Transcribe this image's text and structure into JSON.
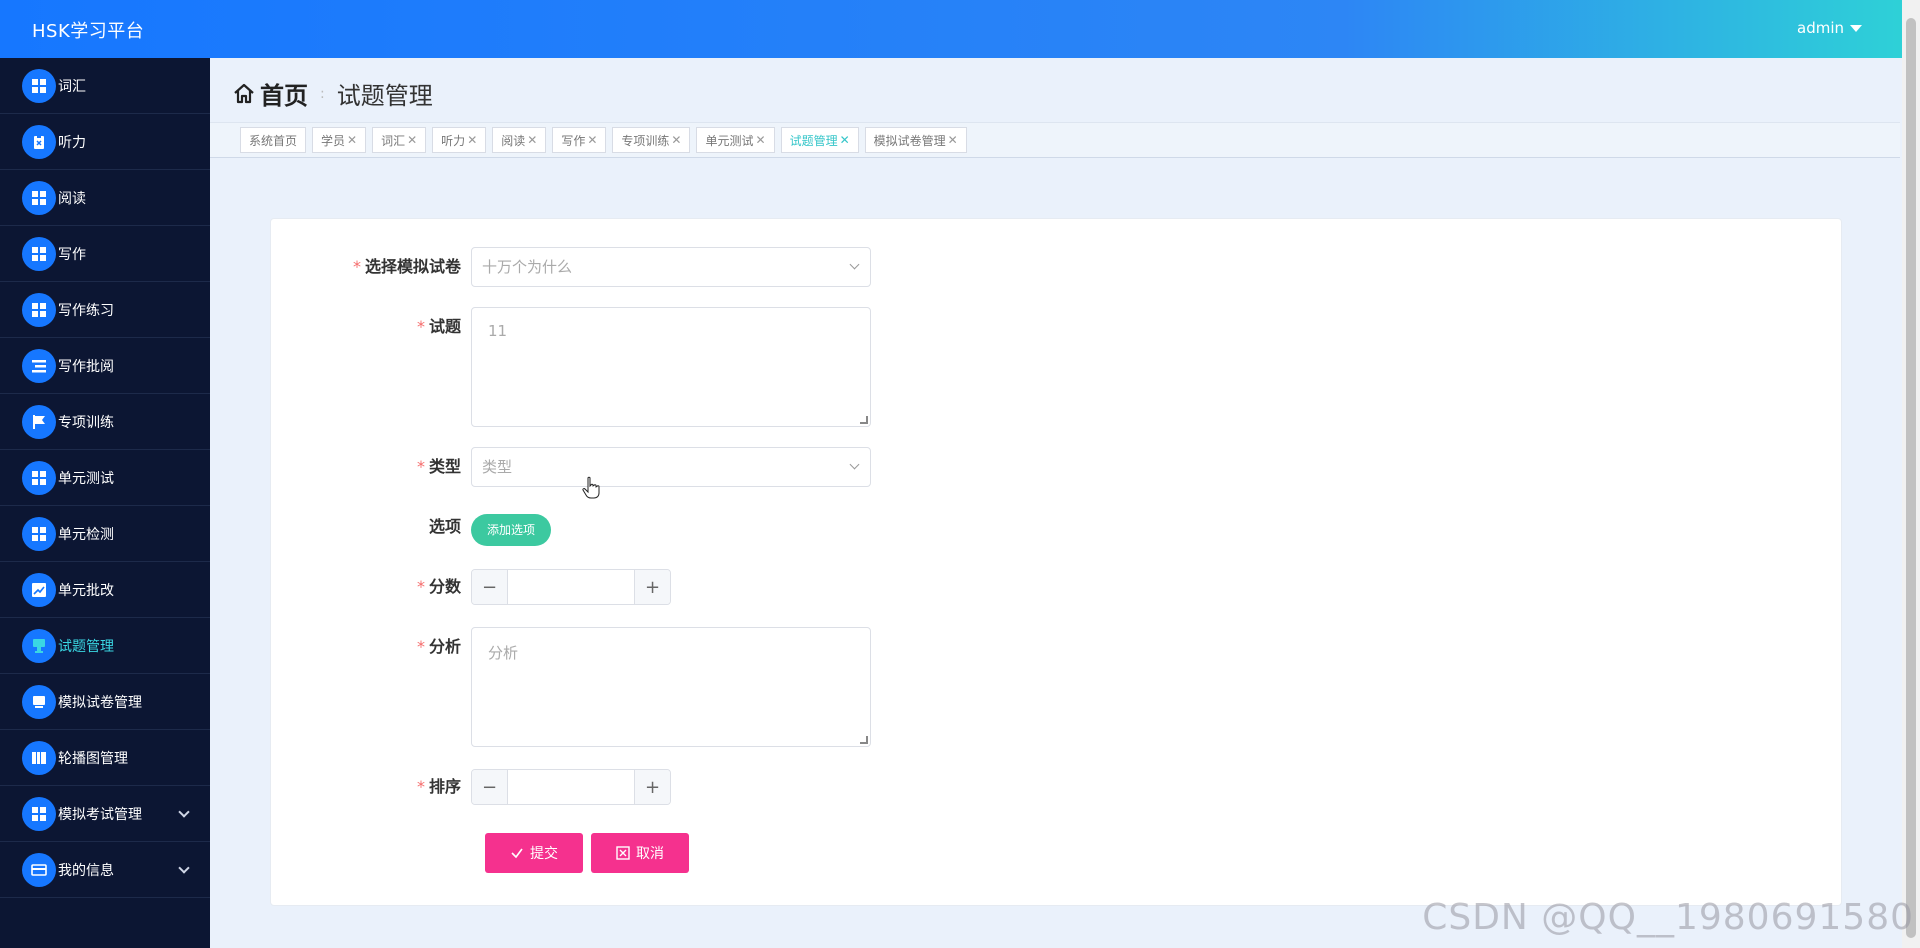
{
  "header": {
    "brand": "HSK学习平台",
    "user": "admin"
  },
  "sidebar": {
    "items": [
      {
        "label": "词汇",
        "icon": "grid-icon"
      },
      {
        "label": "听力",
        "icon": "clipboard-icon"
      },
      {
        "label": "阅读",
        "icon": "grid-icon"
      },
      {
        "label": "写作",
        "icon": "grid-icon"
      },
      {
        "label": "写作练习",
        "icon": "grid-icon"
      },
      {
        "label": "写作批阅",
        "icon": "list-icon"
      },
      {
        "label": "专项训练",
        "icon": "flag-icon"
      },
      {
        "label": "单元测试",
        "icon": "grid-icon"
      },
      {
        "label": "单元检测",
        "icon": "grid-icon"
      },
      {
        "label": "单元批改",
        "icon": "chart-icon"
      },
      {
        "label": "试题管理",
        "icon": "cup-icon",
        "active": true
      },
      {
        "label": "模拟试卷管理",
        "icon": "monitor-icon"
      },
      {
        "label": "轮播图管理",
        "icon": "book-icon"
      },
      {
        "label": "模拟考试管理",
        "icon": "grid-icon",
        "expandable": true
      },
      {
        "label": "我的信息",
        "icon": "card-icon",
        "expandable": true
      }
    ]
  },
  "breadcrumb": {
    "home": "首页",
    "separator": ":",
    "current": "试题管理"
  },
  "tags": [
    {
      "label": "系统首页",
      "closable": false
    },
    {
      "label": "学员",
      "closable": true
    },
    {
      "label": "词汇",
      "closable": true
    },
    {
      "label": "听力",
      "closable": true
    },
    {
      "label": "阅读",
      "closable": true
    },
    {
      "label": "写作",
      "closable": true
    },
    {
      "label": "专项训练",
      "closable": true
    },
    {
      "label": "单元测试",
      "closable": true
    },
    {
      "label": "试题管理",
      "closable": true,
      "active": true
    },
    {
      "label": "模拟试卷管理",
      "closable": true
    }
  ],
  "form": {
    "paper_label": "选择模拟试卷",
    "paper_value": "十万个为什么",
    "question_label": "试题",
    "question_value": "11",
    "type_label": "类型",
    "type_placeholder": "类型",
    "options_label": "选项",
    "add_option": "添加选项",
    "score_label": "分数",
    "analysis_label": "分析",
    "analysis_placeholder": "分析",
    "sort_label": "排序",
    "submit": "提交",
    "cancel": "取消",
    "required_mark": "*",
    "minus": "−",
    "plus": "+"
  },
  "watermark": "CSDN @QQ__1980691580",
  "colors": {
    "header_start": "#1677ff",
    "header_end": "#2ed3d6",
    "sidebar": "#0c1633",
    "accent": "#3ad7e3",
    "primary_button": "#f5318e",
    "add_button": "#3cc9a0",
    "required": "#f56c6c"
  }
}
